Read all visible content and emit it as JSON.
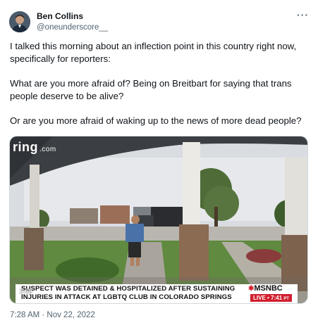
{
  "author": {
    "name": "Ben Collins",
    "handle": "@oneunderscore__"
  },
  "tweet": {
    "paragraphs": [
      "I talked this morning about an inflection point in this country right now, specifically for reporters:",
      "What are you more afraid of? Being on Breitbart for saying that trans people deserve to be alive?",
      "Or are you more afraid of waking up to the news of more dead people?"
    ],
    "timestamp": "7:28 AM · Nov 22, 2022"
  },
  "media": {
    "watermark": "ring",
    "watermark_suffix": ".com",
    "video_time": "2:09",
    "chyron_line1": "SUSPECT WAS DETAINED & HOSPITALIZED AFTER SUSTAINING",
    "chyron_line2": "INJURIES IN ATTACK AT LGBTQ CLUB IN COLORADO SPRINGS",
    "network": "MSNBC",
    "live_label": "LIVE • 7:41",
    "live_suffix": "PT"
  },
  "icons": {
    "more": "more-options-icon",
    "network_logo": "peacock-icon"
  },
  "colors": {
    "text": "#0f1419",
    "secondary": "#536471",
    "live_red": "#d11f2e"
  }
}
